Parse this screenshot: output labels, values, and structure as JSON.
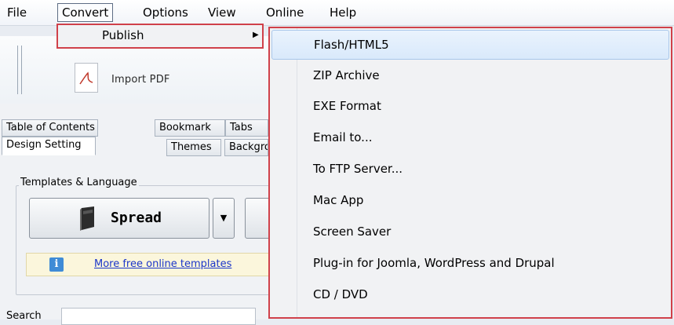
{
  "menubar": {
    "items": [
      "File",
      "Convert",
      "Options",
      "View",
      "Online",
      "Help"
    ]
  },
  "toolbar": {
    "import_label": "Import PDF"
  },
  "panel": {
    "top_tabs": [
      "Table of Contents",
      "Bookmark",
      "Tabs"
    ],
    "sub_tabs": [
      "Design Setting",
      "Themes",
      "Background"
    ],
    "group_title": "Templates & Language",
    "template_button": "Spread",
    "info_link": "More free online templates",
    "search_label": "Search"
  },
  "submenu": {
    "label": "Publish"
  },
  "publish_menu": {
    "items": [
      "Flash/HTML5",
      "ZIP Archive",
      "EXE Format",
      "Email to...",
      "To FTP Server...",
      "Mac App",
      "Screen Saver",
      "Plug-in for Joomla, WordPress and Drupal",
      "CD / DVD"
    ],
    "highlighted_index": 0
  },
  "colors": {
    "highlight_border": "#d0414a",
    "menu_background": "#f1f2f4",
    "selection": "#d9e9fb",
    "link": "#1b36c9"
  }
}
